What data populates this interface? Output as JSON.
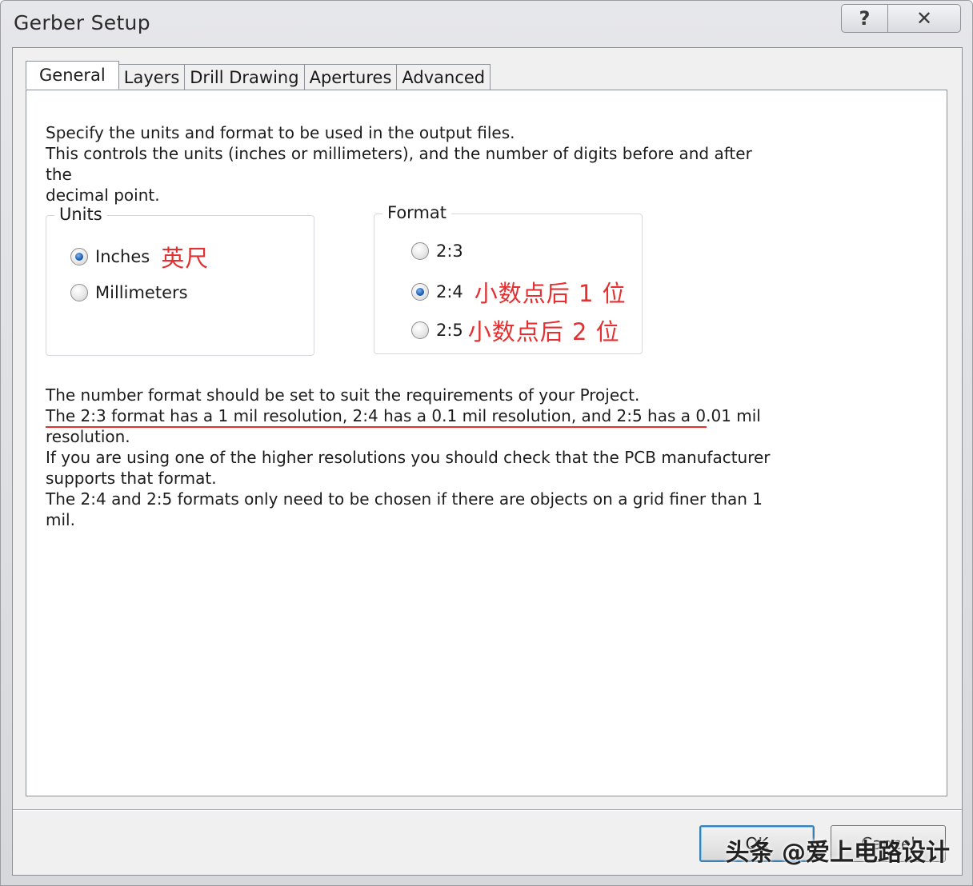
{
  "window": {
    "title": "Gerber Setup",
    "help_glyph": "?",
    "close_glyph": "✕"
  },
  "tabs": [
    {
      "label": "General"
    },
    {
      "label": "Layers"
    },
    {
      "label": "Drill Drawing"
    },
    {
      "label": "Apertures"
    },
    {
      "label": "Advanced"
    }
  ],
  "intro": {
    "line1": "Specify the units and format to be used in the output files.",
    "line2": "This controls the units (inches or millimeters), and the number of digits before and after the",
    "line3": "decimal point."
  },
  "units": {
    "legend": "Units",
    "options": [
      {
        "label": "Inches",
        "checked": true,
        "annotation": "英尺"
      },
      {
        "label": "Millimeters",
        "checked": false
      }
    ]
  },
  "format": {
    "legend": "Format",
    "options": [
      {
        "label": "2:3",
        "checked": false
      },
      {
        "label": "2:4",
        "checked": true,
        "annotation": "小数点后 1 位"
      },
      {
        "label": "2:5",
        "checked": false,
        "annotation": "小数点后 2 位"
      }
    ]
  },
  "notes": {
    "line1": "The number format should be set to suit the requirements of your Project.",
    "line2": "The 2:3 format has a 1 mil resolution, 2:4 has a 0.1 mil resolution, and 2:5 has a 0.01 mil",
    "line3": "resolution.",
    "line4": "If you are using one of the higher resolutions you should check that the PCB manufacturer",
    "line5": "supports that format.",
    "line6": "The 2:4 and 2:5 formats only need to be chosen if there are objects on a grid finer than 1",
    "line7": "mil."
  },
  "buttons": {
    "ok": "OK",
    "cancel": "Cancel"
  },
  "watermark": "头条 @爱上电路设计",
  "colors": {
    "annotation": "#e43030",
    "radio_checked": "#1b5fb0",
    "ok_border": "#3c7fb1"
  }
}
